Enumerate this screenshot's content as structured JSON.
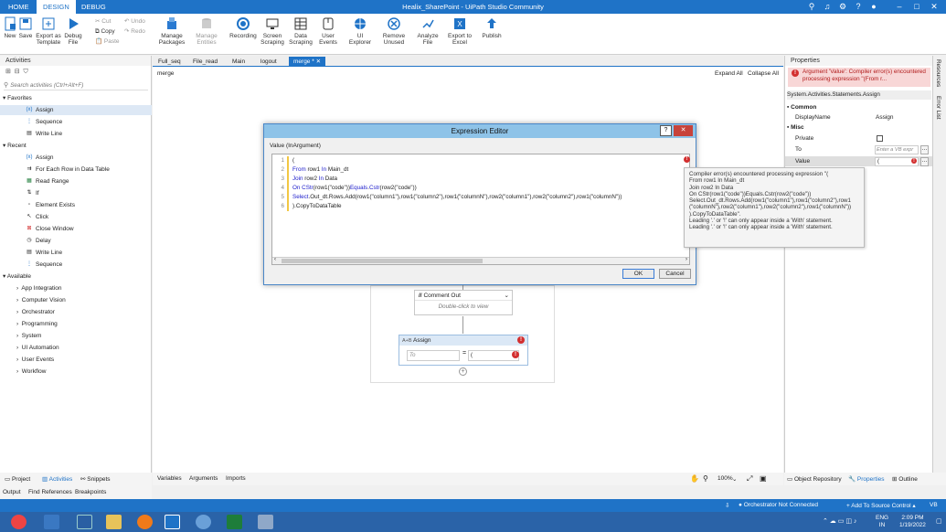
{
  "titlebar": {
    "tabs": [
      "HOME",
      "DESIGN",
      "DEBUG"
    ],
    "active_tab": "DESIGN",
    "title": "Healix_SharePoint - UiPath Studio Community"
  },
  "ribbon": {
    "new": "New",
    "save": "Save",
    "export_template": "Export as Template",
    "debug_file": "Debug File",
    "cut": "Cut",
    "copy": "Copy",
    "paste": "Paste",
    "undo": "Undo",
    "redo": "Redo",
    "manage_packages": "Manage Packages",
    "manage_entities": "Manage Entities",
    "recording": "Recording",
    "screen_scraping": "Screen Scraping",
    "data_scraping": "Data Scraping",
    "user_events": "User Events",
    "ui_explorer": "UI Explorer",
    "remove_unused": "Remove Unused",
    "analyze_file": "Analyze File",
    "export_excel": "Export to Excel",
    "publish": "Publish"
  },
  "activities": {
    "title": "Activities",
    "search_placeholder": "Search activities (Ctrl+Alt+F)",
    "favorites_label": "Favorites",
    "favorites": [
      "Assign",
      "Sequence",
      "Write Line"
    ],
    "recent_label": "Recent",
    "recent": [
      "Assign",
      "For Each Row in Data Table",
      "Read Range",
      "If",
      "Element Exists",
      "Click",
      "Close Window",
      "Delay",
      "Write Line",
      "Sequence"
    ],
    "available_label": "Available",
    "available": [
      "App Integration",
      "Computer Vision",
      "Orchestrator",
      "Programming",
      "System",
      "UI Automation",
      "User Events",
      "Workflow"
    ]
  },
  "doc_tabs": [
    "Full_seq",
    "File_read",
    "Main",
    "logout",
    "merge *"
  ],
  "breadcrumb": "merge",
  "canvas": {
    "expand_all": "Expand All",
    "collapse_all": "Collapse All",
    "comment_out": "Comment Out",
    "double_click": "Double-click to view",
    "assign_title": "Assign",
    "to_placeholder": "To",
    "assign_value": "(",
    "eq": "="
  },
  "dialog": {
    "title": "Expression Editor",
    "help": "?",
    "close": "✕",
    "label": "Value (InArgument)",
    "lines": [
      {
        "n": "1",
        "parts": [
          {
            "t": "(",
            "k": false
          }
        ]
      },
      {
        "n": "2",
        "parts": [
          {
            "t": "From",
            "k": true
          },
          {
            "t": " row1 ",
            "k": false
          },
          {
            "t": "In",
            "k": true
          },
          {
            "t": " Main_dt",
            "k": false
          }
        ]
      },
      {
        "n": "3",
        "parts": [
          {
            "t": "Join",
            "k": true
          },
          {
            "t": " row2 ",
            "k": false
          },
          {
            "t": "In",
            "k": true
          },
          {
            "t": " Data",
            "k": false
          }
        ]
      },
      {
        "n": "4",
        "parts": [
          {
            "t": "On",
            "k": true
          },
          {
            "t": " ",
            "k": false
          },
          {
            "t": "CStr",
            "k": true
          },
          {
            "t": "(row1(\"code\"))",
            "k": false
          },
          {
            "t": "Equals",
            "k": true
          },
          {
            "t": ".",
            "k": false
          },
          {
            "t": "Cstr",
            "k": true
          },
          {
            "t": "(row2(\"code\"))",
            "k": false
          }
        ]
      },
      {
        "n": "5",
        "parts": [
          {
            "t": "Select",
            "k": true
          },
          {
            "t": ".Out_dt.Rows.Add(row1(\"column1\"),row1(\"column2\"),row1(\"columnN\"),row2(\"column1\"),row2(\"column2\"),row1(\"columnN\"))",
            "k": false
          }
        ]
      },
      {
        "n": "6",
        "parts": [
          {
            "t": ").CopyToDataTable",
            "k": false
          }
        ]
      }
    ],
    "ok": "OK",
    "cancel": "Cancel"
  },
  "tooltip": {
    "lines": [
      "Compiler error(s) encountered processing expression \"(",
      "From row1 In Main_dt",
      "Join row2 In Data",
      "On CStr(row1(\"code\"))Equals.Cstr(row2(\"code\"))",
      "Select.Out_dt.Rows.Add(row1(\"column1\"),row1(\"column2\"),row1",
      "(\"columnN\"),row2(\"column1\"),row2(\"column2\"),row1(\"columnN\"))",
      ").CopyToDataTable\".",
      "Leading '.' or '!' can only appear inside a 'With' statement.",
      "Leading '.' or '!' can only appear inside a 'With' statement."
    ]
  },
  "properties": {
    "title": "Properties",
    "error": "Argument 'Value': Compiler error(s) encountered processing expression \"(From r...",
    "type_name": "System.Activities.Statements.Assign",
    "common_label": "Common",
    "display_name_label": "DisplayName",
    "display_name_value": "Assign",
    "misc_label": "Misc",
    "private_label": "Private",
    "to_label": "To",
    "to_placeholder": "Enter a VB expr",
    "value_label": "Value",
    "value_value": "("
  },
  "right_strip": [
    "Resources",
    "Error List"
  ],
  "bottom_left_tabs": [
    "Project",
    "Activities",
    "Snippets"
  ],
  "bottom_left_tabs2": [
    "Output",
    "Find References",
    "Breakpoints"
  ],
  "bottom_center_tabs": [
    "Variables",
    "Arguments",
    "Imports"
  ],
  "zoom": "100%",
  "bottom_right_tabs": [
    "Object Repository",
    "Properties",
    "Outline"
  ],
  "status": {
    "orchestrator": "Orchestrator Not Connected",
    "source_control": "Add To Source Control",
    "lang": "VB"
  },
  "taskbar": {
    "lang": "ENG",
    "region": "IN",
    "time": "2:09 PM",
    "date": "1/19/2022"
  },
  "colors": {
    "accent": "#1f73c7",
    "error": "#d32f2f",
    "dialog_title": "#8ec3e8"
  }
}
